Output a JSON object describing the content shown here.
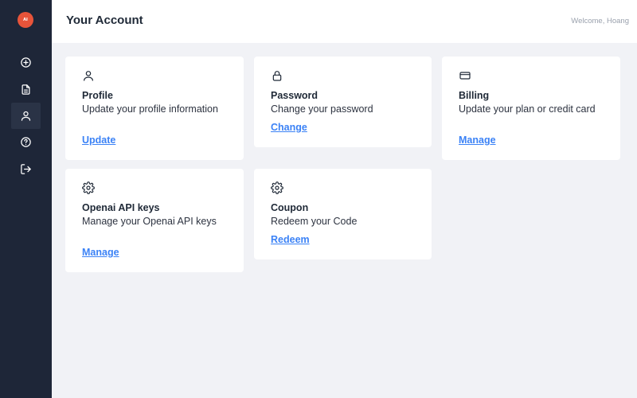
{
  "sidebar": {
    "logo_text": "AI",
    "items": [
      {
        "name": "add",
        "icon": "plus-circle-icon"
      },
      {
        "name": "documents",
        "icon": "document-icon"
      },
      {
        "name": "account",
        "icon": "user-icon",
        "active": true
      },
      {
        "name": "help",
        "icon": "question-circle-icon"
      },
      {
        "name": "logout",
        "icon": "logout-icon"
      }
    ]
  },
  "header": {
    "title": "Your Account",
    "welcome": "Welcome, Hoang"
  },
  "cards": [
    {
      "icon": "user-icon",
      "title": "Profile",
      "description": "Update your profile information",
      "link": "Update"
    },
    {
      "icon": "lock-icon",
      "title": "Password",
      "description": "Change your password",
      "link": "Change"
    },
    {
      "icon": "credit-card-icon",
      "title": "Billing",
      "description": "Update your plan or credit card",
      "link": "Manage"
    },
    {
      "icon": "gear-icon",
      "title": "Openai API keys",
      "description": "Manage your Openai API keys",
      "link": "Manage"
    },
    {
      "icon": "gear-icon",
      "title": "Coupon",
      "description": "Redeem your Code",
      "link": "Redeem"
    }
  ],
  "colors": {
    "sidebar_bg": "#1e2638",
    "link": "#3b82f6",
    "page_bg": "#f1f2f6",
    "logo": "#e8543a"
  }
}
